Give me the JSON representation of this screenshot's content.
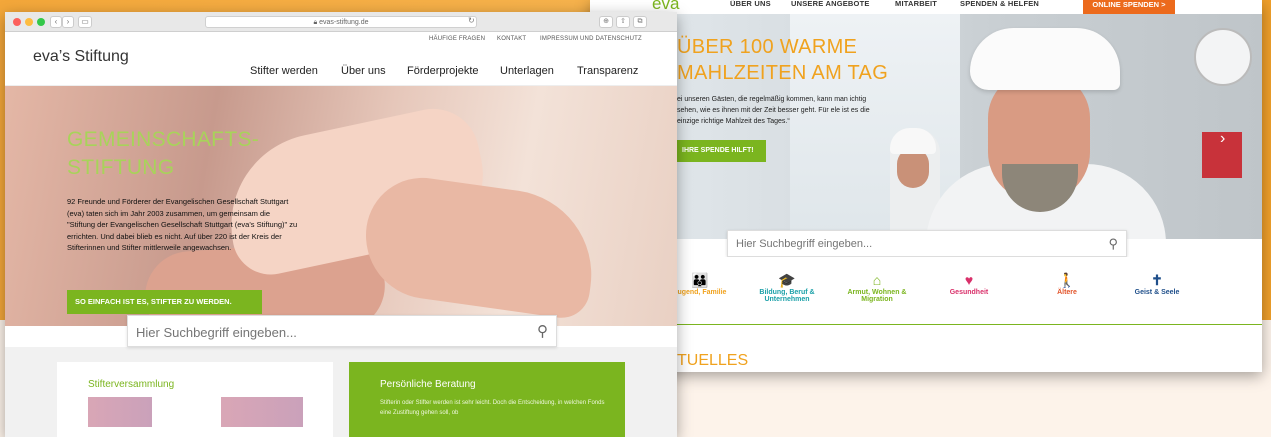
{
  "colors": {
    "brand_green": "#7bb51f",
    "brand_orange": "#f0a21e",
    "donate_orange": "#ec6a1c",
    "background_orange": "#f5a524"
  },
  "right_site": {
    "logo": "eva",
    "nav": [
      "ÜBER UNS",
      "UNSERE ANGEBOTE",
      "MITARBEIT",
      "SPENDEN & HELFEN"
    ],
    "donate_button": "ONLINE SPENDEN >",
    "hero_title_line1": "ÜBER 100 WARME",
    "hero_title_line2": "MAHLZEITEN AM TAG",
    "hero_text": "ei unseren Gästen, die regelmäßig kommen, kann man ichtig sehen, wie es ihnen mit der Zeit besser geht. Für ele ist es die einzige richtige Mahlzeit des Tages.“",
    "hero_button": "IHRE SPENDE HILFT!",
    "search_placeholder": "Hier Suchbegriff eingeben...",
    "categories": [
      {
        "label": "Jugend, Familie",
        "color": "#f0a21e",
        "icon": "family-icon",
        "glyph": "👪"
      },
      {
        "label": "Bildung, Beruf & Unternehmen",
        "color": "#1aa0a8",
        "icon": "graduation-cap-icon",
        "glyph": "🎓"
      },
      {
        "label": "Armut, Wohnen & Migration",
        "color": "#7bb51f",
        "icon": "house-icon",
        "glyph": "⌂"
      },
      {
        "label": "Gesundheit",
        "color": "#d9306a",
        "icon": "heart-icon",
        "glyph": "♥"
      },
      {
        "label": "Ältere",
        "color": "#e2542a",
        "icon": "walking-person-icon",
        "glyph": "🚶"
      },
      {
        "label": "Geist & Seele",
        "color": "#1f4f8a",
        "icon": "cross-icon",
        "glyph": "✝"
      }
    ],
    "section_title": "TUELLES"
  },
  "left_site": {
    "url": "evas-stiftung.de",
    "logo_text": "eva’s Stiftung",
    "top_links": [
      "HÄUFIGE FRAGEN",
      "KONTAKT",
      "IMPRESSUM UND DATENSCHUTZ"
    ],
    "main_nav": [
      "Stifter werden",
      "Über uns",
      "Förderprojekte",
      "Unterlagen",
      "Transparenz"
    ],
    "hero_title_line1": "GEMEINSCHAFTS-",
    "hero_title_line2": "STIFTUNG",
    "hero_text": "92 Freunde und Förderer der Evangelischen Gesellschaft Stuttgart (eva) taten sich im Jahr 2003 zusammen, um gemeinsam die \"Stiftung der Evangelischen Gesellschaft Stuttgart (eva's Stiftung)\" zu errichten. Und dabei blieb es nicht. Auf über 220 ist der Kreis der Stifterinnen und Stifter mittlerweile angewachsen.",
    "hero_button": "SO EINFACH IST ES, STIFTER ZU WERDEN.",
    "search_placeholder": "Hier Suchbegriff eingeben...",
    "card_left_title": "Stifterversammlung",
    "card_right_title": "Persönliche Beratung",
    "card_right_text": "Stifterin oder Stifter werden ist sehr leicht. Doch die Entscheidung, in welchen Fonds eine Zustiftung gehen soll, ob"
  }
}
